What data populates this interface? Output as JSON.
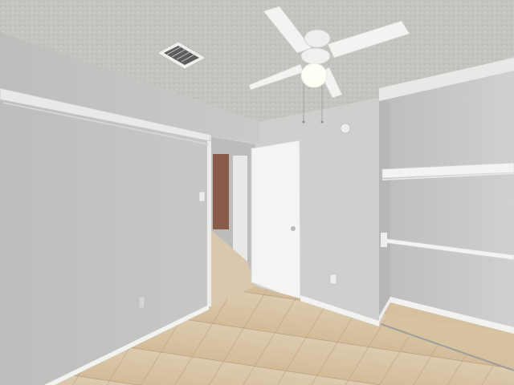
{
  "scene": {
    "subject": "empty-bedroom",
    "colors": {
      "ceiling": "#c4c4c1",
      "wall_left": "#c3c3c1",
      "wall_back": "#cfcfcd",
      "closet_back": "#c9c9c7",
      "baseboard": "#f2f2f0",
      "door": "#f4f4f2",
      "floor_tile": "#d8c3a4",
      "grout": "#b59d7c",
      "fan_white": "#f3f3f1",
      "fan_light": "#fffff6"
    },
    "elements": {
      "vent": "hvac-vent-icon",
      "fan": "ceiling-fan-icon",
      "smoke_detector": "smoke-detector-icon",
      "light_switch": "light-switch-icon",
      "outlet": "power-outlet-icon",
      "door_knob": "door-knob-icon"
    }
  }
}
